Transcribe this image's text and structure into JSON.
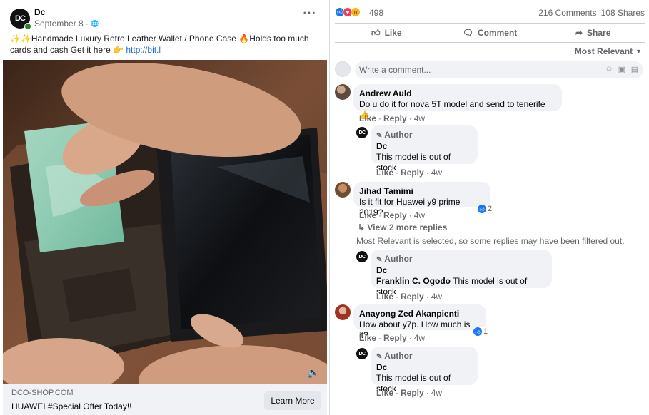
{
  "post": {
    "page_name": "Dc",
    "page_avatar_text": "DC",
    "date": "September 8 ·",
    "text_prefix_emoji": "✨✨",
    "text_main": "Handmade Luxury Retro Leather Wallet / Phone Case ",
    "text_fire_emoji": "🔥",
    "text_after_fire": "Holds too much cards and cash Get it here ",
    "text_point_emoji": "👉",
    "link_text": "http://bit.l",
    "link_footer": {
      "domain": "DCO-SHOP.COM",
      "title": "HUAWEI #Special Offer Today!!",
      "button_label": "Learn More"
    }
  },
  "reactions": {
    "count": "498",
    "comments": "216 Comments",
    "shares": "108 Shares"
  },
  "actions": {
    "like": "Like",
    "comment": "Comment",
    "share": "Share"
  },
  "sort_label": "Most Relevant",
  "comment_placeholder": "Write a comment...",
  "comments": [
    {
      "name": "Andrew Auld",
      "text": "Do u do it for nova 5T model and send to tenerife 👍",
      "like": "Like",
      "reply": "Reply",
      "time": "4w",
      "replies": [
        {
          "badge": "Author",
          "name": "Dc",
          "text": "This model is out of stock",
          "like": "Like",
          "reply": "Reply",
          "time": "4w"
        }
      ]
    },
    {
      "name": "Jihad Tamimi",
      "text": "Is it fit for Huawei y9 prime 2019?",
      "reaction_count": "2",
      "like": "Like",
      "reply": "Reply",
      "time": "4w",
      "view_more": "View 2 more replies",
      "filter_note": "Most Relevant is selected, so some replies may have been filtered out.",
      "replies": [
        {
          "badge": "Author",
          "name": "Dc",
          "mention": "Franklin C. Ogodo",
          "text": "This model is out of stock",
          "like": "Like",
          "reply": "Reply",
          "time": "4w"
        }
      ]
    },
    {
      "name": "Anayong Zed Akanpienti",
      "text": "How about y7p. How much is it?",
      "reaction_count": "1",
      "like": "Like",
      "reply": "Reply",
      "time": "4w",
      "replies": [
        {
          "badge": "Author",
          "name": "Dc",
          "text": "This model is out of stock",
          "like": "Like",
          "reply": "Reply",
          "time": "4w"
        }
      ]
    }
  ]
}
